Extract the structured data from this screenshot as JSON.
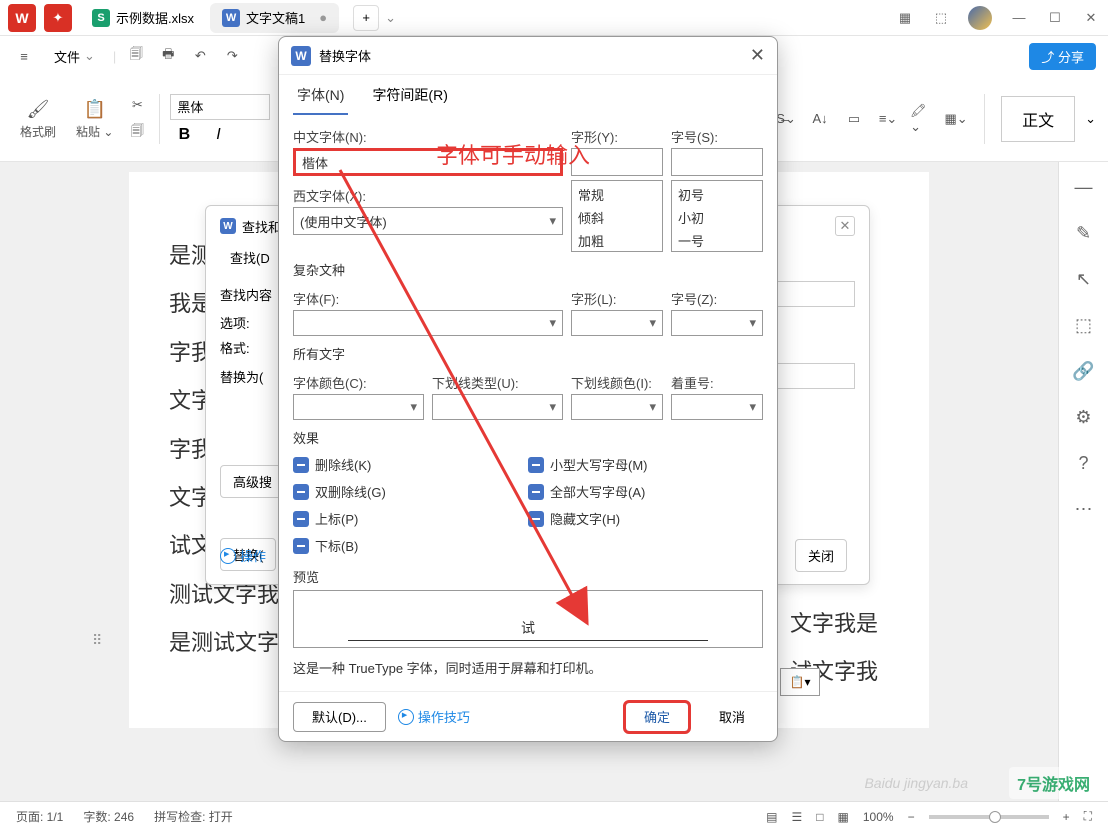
{
  "titlebar": {
    "tabs": [
      {
        "label": "示例数据.xlsx",
        "icon": "S"
      },
      {
        "label": "文字文稿1",
        "icon": "W"
      }
    ]
  },
  "menubar": {
    "file": "文件",
    "share": "分享"
  },
  "ribbon": {
    "format_painter": "格式刷",
    "paste": "粘贴",
    "font_name": "黑体",
    "style_name": "正文"
  },
  "doc_lines": [
    "",
    "是测",
    "我是",
    "字我",
    "文字",
    "字我",
    "文字",
    "试文字我是",
    "测试文字我",
    "是测试文字"
  ],
  "doc_right_fragments": [
    "文字我是",
    "试文字我"
  ],
  "findreplace": {
    "title": "查找和",
    "tab_find": "查找(D",
    "content_label": "查找内容",
    "options_label": "选项:",
    "format_label": "格式:",
    "replace_label": "替换为(",
    "advanced_btn": "高级搜",
    "replace_btn": "替换(",
    "tips": "操作",
    "close": "关闭"
  },
  "fontdlg": {
    "title": "替换字体",
    "tab_font": "字体(N)",
    "tab_spacing": "字符间距(R)",
    "chinese_font_label": "中文字体(N):",
    "chinese_font_value": "楷体",
    "style_label": "字形(Y):",
    "size_label": "字号(S):",
    "style_options": [
      "常规",
      "倾斜",
      "加粗"
    ],
    "size_options": [
      "初号",
      "小初",
      "一号"
    ],
    "western_font_label": "西文字体(X):",
    "western_font_value": "(使用中文字体)",
    "complex_section": "复杂文种",
    "complex_font_label": "字体(F):",
    "complex_style_label": "字形(L):",
    "complex_size_label": "字号(Z):",
    "all_text_section": "所有文字",
    "font_color_label": "字体颜色(C):",
    "underline_type_label": "下划线类型(U):",
    "underline_color_label": "下划线颜色(I):",
    "emphasis_label": "着重号:",
    "effects_section": "效果",
    "effects_left": [
      "删除线(K)",
      "双删除线(G)",
      "上标(P)",
      "下标(B)"
    ],
    "effects_right": [
      "小型大写字母(M)",
      "全部大写字母(A)",
      "隐藏文字(H)"
    ],
    "preview_label": "预览",
    "preview_text": "试",
    "truetype_note": "这是一种 TrueType 字体，同时适用于屏幕和打印机。",
    "default_btn": "默认(D)...",
    "tips_link": "操作技巧",
    "ok_btn": "确定",
    "cancel_btn": "取消"
  },
  "annotation": {
    "red_text": "字体可手动输入"
  },
  "statusbar": {
    "page": "页面: 1/1",
    "words": "字数: 246",
    "spell": "拼写检查: 打开",
    "zoom": "100%"
  },
  "paste_options": "📋▾",
  "watermark": {
    "site": "7号游戏网",
    "baidu": "jingyan.ba"
  }
}
